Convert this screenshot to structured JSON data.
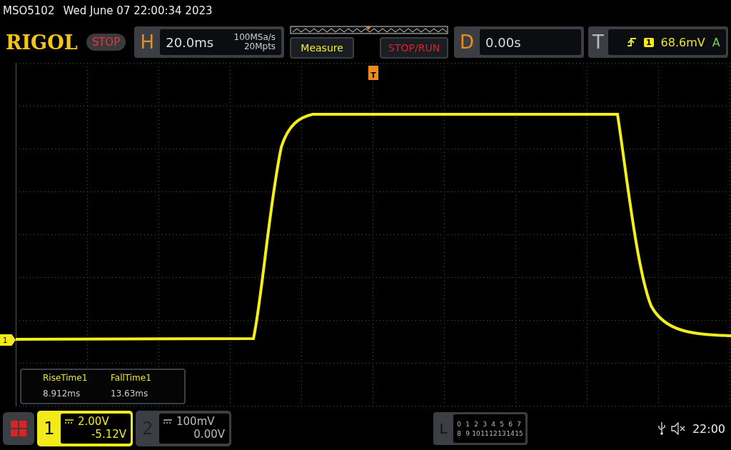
{
  "header": {
    "model": "MSO5102",
    "datetime": "Wed June 07 22:00:34 2023"
  },
  "logo": "RIGOL",
  "run_state": "STOP",
  "horizontal": {
    "label": "H",
    "timebase": "20.0ms",
    "sample_rate": "100MSa/s",
    "memory_depth": "20Mpts"
  },
  "buttons": [
    {
      "label": "Measure",
      "kind": "measure"
    },
    {
      "label": "STOP/RUN",
      "kind": "stoprun"
    }
  ],
  "delay": {
    "label": "D",
    "value": "0.00s"
  },
  "trigger": {
    "label": "T",
    "channel": "1",
    "level": "68.6mV",
    "mode": "A"
  },
  "trigger_marker": "T",
  "channel_marker": "1",
  "measurements": [
    {
      "name": "RiseTime1",
      "value": "8.912ms"
    },
    {
      "name": "FallTime1",
      "value": "13.63ms"
    }
  ],
  "channels": [
    {
      "number": "1",
      "scale": "2.00V",
      "offset": "-5.12V",
      "selected": true
    },
    {
      "number": "2",
      "scale": "100mV",
      "offset": "0.00V",
      "selected": false
    }
  ],
  "logic": {
    "label": "L",
    "rows": [
      [
        "0",
        "1",
        "2",
        "3",
        "4",
        "5",
        "6",
        "7"
      ],
      [
        "8",
        "9",
        "10",
        "11",
        "12",
        "13",
        "14",
        "15"
      ]
    ]
  },
  "status": {
    "time": "22:00"
  }
}
